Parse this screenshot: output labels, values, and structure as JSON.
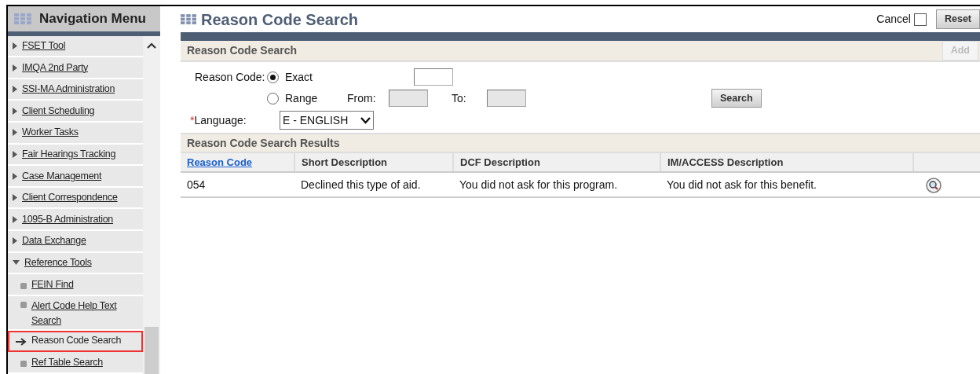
{
  "nav": {
    "title": "Navigation Menu",
    "items": [
      {
        "label": "FSET Tool",
        "kind": "group",
        "expanded": false,
        "selected": false
      },
      {
        "label": "IMQA 2nd Party",
        "kind": "group",
        "expanded": false,
        "selected": false
      },
      {
        "label": "SSI-MA Administration",
        "kind": "group",
        "expanded": false,
        "selected": false
      },
      {
        "label": "Client Scheduling",
        "kind": "group",
        "expanded": false,
        "selected": false
      },
      {
        "label": "Worker Tasks",
        "kind": "group",
        "expanded": false,
        "selected": false
      },
      {
        "label": "Fair Hearings Tracking",
        "kind": "group",
        "expanded": false,
        "selected": false
      },
      {
        "label": "Case Management",
        "kind": "group",
        "expanded": false,
        "selected": false
      },
      {
        "label": "Client Correspondence",
        "kind": "group",
        "expanded": false,
        "selected": false
      },
      {
        "label": "1095-B Administration",
        "kind": "group",
        "expanded": false,
        "selected": false
      },
      {
        "label": "Data Exchange",
        "kind": "group",
        "expanded": false,
        "selected": false
      },
      {
        "label": "Reference Tools",
        "kind": "group",
        "expanded": true,
        "selected": false,
        "children": [
          {
            "label": "FEIN Find",
            "kind": "page",
            "selected": false
          },
          {
            "label": "Alert Code Help Text Search",
            "kind": "page",
            "selected": false
          },
          {
            "label": "Reason Code Search",
            "kind": "page",
            "selected": true
          },
          {
            "label": "Ref Table Search",
            "kind": "page",
            "selected": false
          }
        ]
      }
    ]
  },
  "page": {
    "title": "Reason Code Search",
    "cancel_label": "Cancel",
    "cancel_checked": false,
    "reset_button": "Reset"
  },
  "search_section": {
    "title": "Reason Code Search",
    "add_button": "Add",
    "reason_code_label": "Reason Code:",
    "modes": [
      {
        "label": "Exact",
        "selected": true
      },
      {
        "label": "Range",
        "selected": false
      }
    ],
    "from_label": "From:",
    "to_label": "To:",
    "language_label": "Language:",
    "required_mark": "*",
    "language_value": "E - ENGLISH",
    "search_button": "Search"
  },
  "results": {
    "title": "Reason Code Search Results",
    "columns": [
      {
        "label": "Reason Code",
        "sortable": true
      },
      {
        "label": "Short Description",
        "sortable": false
      },
      {
        "label": "DCF Description",
        "sortable": false
      },
      {
        "label": "IM/ACCESS Description",
        "sortable": false
      }
    ],
    "rows": [
      {
        "cells": [
          "054",
          "Declined this type of aid.",
          "You did not ask for this program.",
          "You did not ask for this benefit."
        ]
      }
    ]
  }
}
